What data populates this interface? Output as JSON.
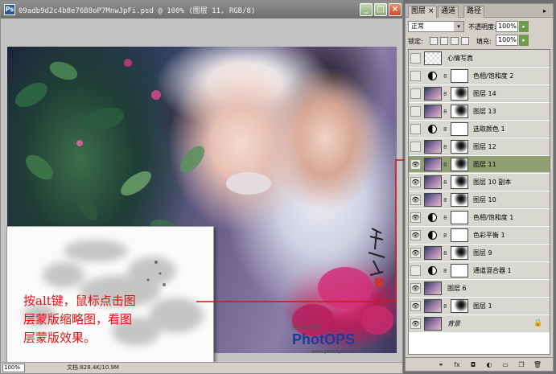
{
  "document": {
    "title": "09adb9d2c4b8e76B8oP7MnwJpFi.psd @ 100% (图层 11, RGB/8)",
    "app_icon": "Ps",
    "zoom": "100%",
    "doc_size": "文档:828.4K/10.9M",
    "min_label": "_",
    "max_label": "□",
    "close_label": "×"
  },
  "annotation": {
    "lines": [
      "按alt键，鼠标点击图",
      "层蒙版缩略图，看图",
      "层蒙版效果。"
    ],
    "color": "#dd1111"
  },
  "watermark": {
    "top": "照片处理网",
    "brand": "PhotOPS",
    "url": "www.photops.com"
  },
  "panel": {
    "tabs": [
      "图层",
      "通道",
      "路径"
    ],
    "tab_close": "×",
    "menu_icon": "▸",
    "blend_mode": "正常",
    "blend_arrow": "▾",
    "opacity_label": "不透明度:",
    "opacity_value": "100%",
    "lock_label": "锁定:",
    "fill_label": "填充:",
    "fill_value": "100%",
    "step_arrow": "▸",
    "layers": [
      {
        "name": "心情写真",
        "visible": false,
        "kind": "text"
      },
      {
        "name": "色相/饱和度 2",
        "visible": false,
        "kind": "adjust"
      },
      {
        "name": "图层 14",
        "visible": false,
        "kind": "masked"
      },
      {
        "name": "图层 13",
        "visible": false,
        "kind": "masked"
      },
      {
        "name": "选取颜色 1",
        "visible": false,
        "kind": "adjust"
      },
      {
        "name": "图层 12",
        "visible": false,
        "kind": "masked"
      },
      {
        "name": "图层 11",
        "visible": true,
        "kind": "masked",
        "selected": true
      },
      {
        "name": "图层 10 副本",
        "visible": true,
        "kind": "masked"
      },
      {
        "name": "图层 10",
        "visible": true,
        "kind": "masked"
      },
      {
        "name": "色相/饱和度 1",
        "visible": true,
        "kind": "adjust"
      },
      {
        "name": "色彩平衡 1",
        "visible": true,
        "kind": "adjust"
      },
      {
        "name": "图层 9",
        "visible": true,
        "kind": "masked"
      },
      {
        "name": "通道混合器 1",
        "visible": false,
        "kind": "adjust"
      },
      {
        "name": "图层 6",
        "visible": true,
        "kind": "plain"
      },
      {
        "name": "图层 1",
        "visible": true,
        "kind": "masked"
      },
      {
        "name": "背景",
        "visible": true,
        "kind": "background",
        "locked": true
      }
    ],
    "bottom_icons": [
      "link-icon",
      "fx-icon",
      "mask-icon",
      "adjustment-icon",
      "group-icon",
      "new-layer-icon",
      "trash-icon"
    ]
  },
  "icons": {
    "eye": "👁",
    "chain": "8",
    "lock": "🔒"
  }
}
